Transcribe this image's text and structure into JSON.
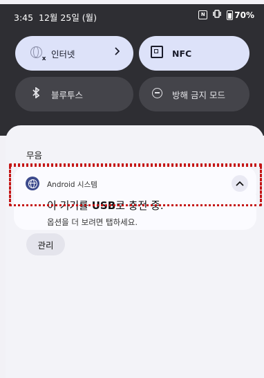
{
  "status_bar": {
    "time": "3:45",
    "date": "12월 25일 (월)",
    "icons": [
      "nfc-icon",
      "vibrate-icon",
      "battery-icon"
    ],
    "battery_percent": "70%"
  },
  "quick_tiles": [
    {
      "label": "인터넷",
      "icon": "internet-icon",
      "active": true,
      "has_chevron": true
    },
    {
      "label": "NFC",
      "icon": "nfc-icon",
      "active": true
    },
    {
      "label": "블루투스",
      "icon": "bluetooth-icon",
      "active": false
    },
    {
      "label": "방해 금지 모드",
      "icon": "do-not-disturb-icon",
      "active": false
    }
  ],
  "notifications": {
    "section_label": "무음",
    "card": {
      "app_name": "Android 시스템",
      "title_prefix": "이 기기를 ",
      "title_bold": "USB",
      "title_suffix": "로 충전 중.",
      "subtitle": "옵션을 더 보려면 탭하세요.",
      "icon": "android-system-icon",
      "expand_icon": "chevron-up-icon"
    },
    "manage_label": "관리"
  },
  "colors": {
    "shade_bg": "#2e2e33",
    "tile_active": "#dde2f9",
    "tile_inactive": "#44444a",
    "panel_bg": "#f3f3f8",
    "highlight": "#c51616",
    "app_icon": "#3c4a8c"
  }
}
